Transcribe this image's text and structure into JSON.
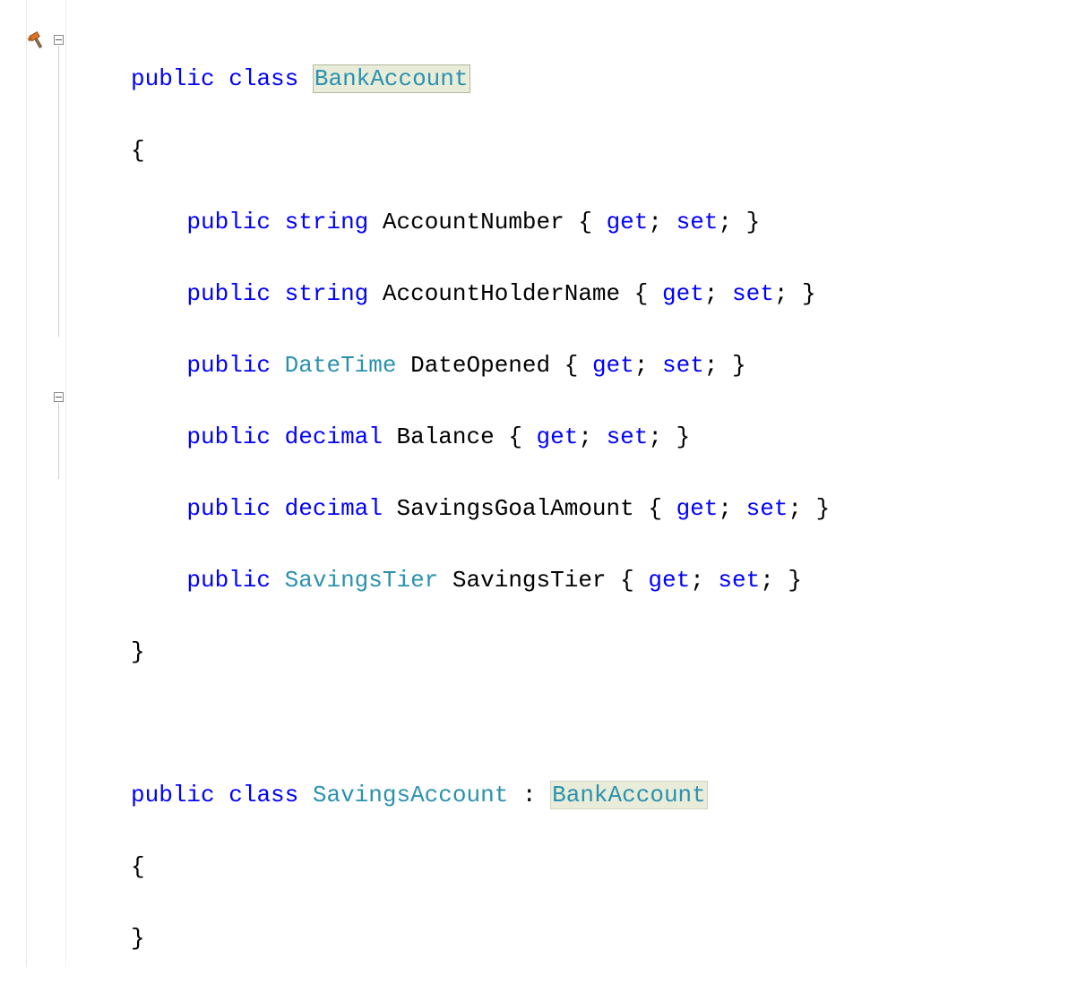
{
  "code": {
    "class1": {
      "modifier": "public",
      "kw_class": "class",
      "name": "BankAccount",
      "props": [
        {
          "mod": "public",
          "type": "string",
          "typeColor": "kw",
          "name": "AccountNumber"
        },
        {
          "mod": "public",
          "type": "string",
          "typeColor": "kw",
          "name": "AccountHolderName"
        },
        {
          "mod": "public",
          "type": "DateTime",
          "typeColor": "type",
          "name": "DateOpened"
        },
        {
          "mod": "public",
          "type": "decimal",
          "typeColor": "kw",
          "name": "Balance"
        },
        {
          "mod": "public",
          "type": "decimal",
          "typeColor": "kw",
          "name": "SavingsGoalAmount"
        },
        {
          "mod": "public",
          "type": "SavingsTier",
          "typeColor": "type",
          "name": "SavingsTier"
        }
      ],
      "accessor_get": "get",
      "accessor_set": "set"
    },
    "class2": {
      "modifier": "public",
      "kw_class": "class",
      "name": "SavingsAccount",
      "base": "BankAccount"
    },
    "braces": {
      "open": "{",
      "close": "}",
      "semi": ";",
      "colon": ":"
    }
  }
}
